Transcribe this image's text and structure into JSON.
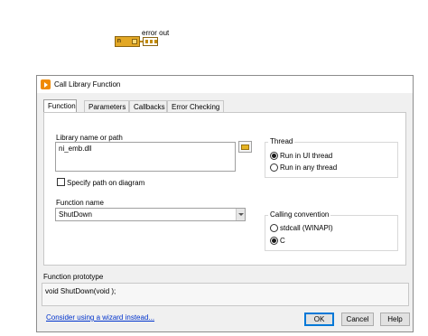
{
  "block_diagram": {
    "node_label": "n",
    "indicator_label": "error out"
  },
  "dialog": {
    "title": "Call Library Function",
    "tabs": [
      {
        "label": "Function",
        "active": true
      },
      {
        "label": "Parameters",
        "active": false
      },
      {
        "label": "Callbacks",
        "active": false
      },
      {
        "label": "Error Checking",
        "active": false
      }
    ],
    "library": {
      "label": "Library name or path",
      "value": "ni_emb.dll"
    },
    "specify_path": {
      "label": "Specify path on diagram",
      "checked": false
    },
    "function_name": {
      "label": "Function name",
      "value": "ShutDown"
    },
    "thread": {
      "title": "Thread",
      "options": [
        {
          "label": "Run in UI thread",
          "selected": true
        },
        {
          "label": "Run in any thread",
          "selected": false
        }
      ]
    },
    "calling_convention": {
      "title": "Calling convention",
      "options": [
        {
          "label": "stdcall (WINAPI)",
          "selected": false
        },
        {
          "label": "C",
          "selected": true
        }
      ]
    },
    "prototype": {
      "label": "Function prototype",
      "value": "void  ShutDown(void );"
    },
    "wizard_link": "Consider using a wizard instead...",
    "buttons": {
      "ok": "OK",
      "cancel": "Cancel",
      "help": "Help"
    }
  }
}
